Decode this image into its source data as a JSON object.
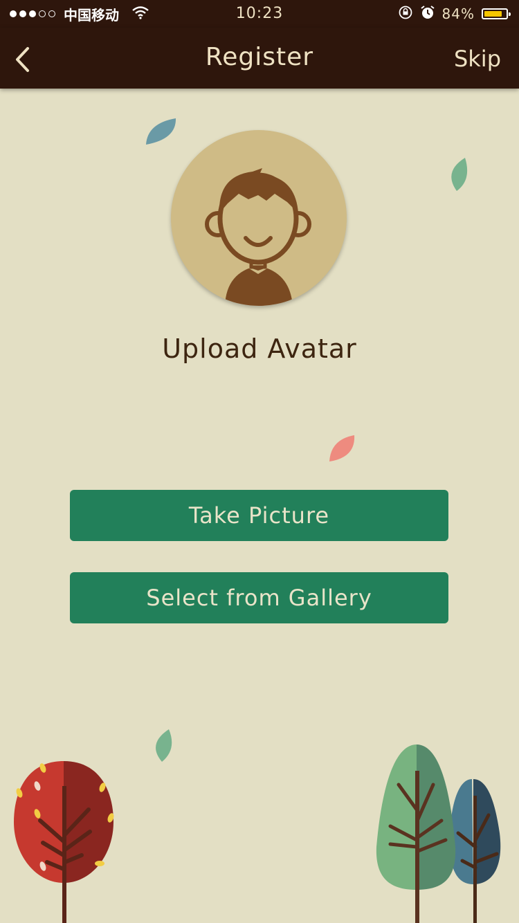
{
  "status_bar": {
    "carrier": "中国移动",
    "time": "10:23",
    "battery_percent": "84%",
    "battery_level": 0.84,
    "signal_bars_filled": 3,
    "signal_bars_total": 5
  },
  "nav": {
    "back_icon": "chevron-left-icon",
    "title": "Register",
    "skip_label": "Skip"
  },
  "avatar": {
    "icon": "avatar-placeholder-icon"
  },
  "upload_label": "Upload Avatar",
  "buttons": {
    "take_picture": "Take Picture",
    "select_gallery": "Select from Gallery"
  },
  "colors": {
    "background": "#e3dfc4",
    "nav_bar": "#2e160c",
    "nav_text": "#efe2c3",
    "button": "#22805a",
    "button_text": "#e9e4c9",
    "avatar_circle": "#cfbb86",
    "avatar_figure": "#7a4a22",
    "heading_text": "#3d2510"
  }
}
